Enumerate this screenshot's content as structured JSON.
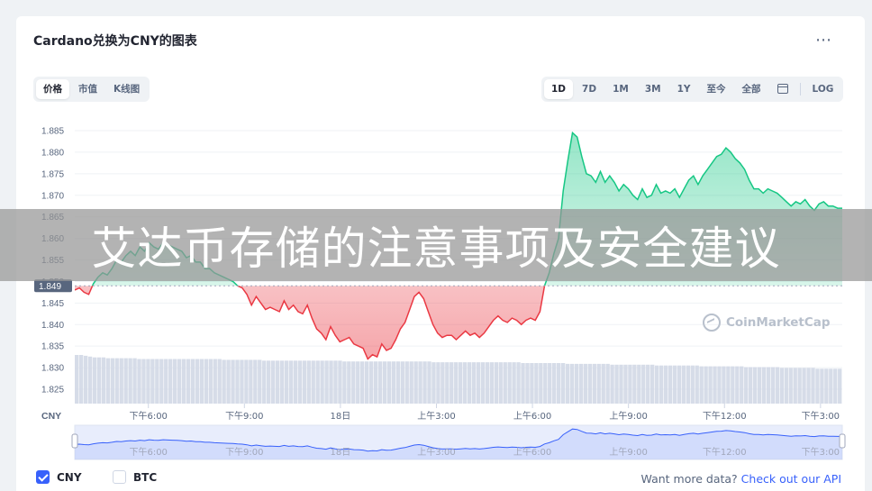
{
  "title": "Cardano兑换为CNY的图表",
  "more_icon": "⋯",
  "tabs_left": [
    {
      "label": "价格",
      "active": true
    },
    {
      "label": "市值",
      "active": false
    },
    {
      "label": "K线图",
      "active": false
    }
  ],
  "tabs_right": [
    {
      "label": "1D",
      "active": true
    },
    {
      "label": "7D",
      "active": false
    },
    {
      "label": "1M",
      "active": false
    },
    {
      "label": "3M",
      "active": false
    },
    {
      "label": "1Y",
      "active": false
    },
    {
      "label": "至今",
      "active": false
    },
    {
      "label": "全部",
      "active": false
    }
  ],
  "log_label": "LOG",
  "calendar_icon": "calendar-icon",
  "banner_text": "艾达币存储的注意事项及安全建议",
  "watermark": "CoinMarketCap",
  "legend": [
    {
      "label": "CNY",
      "checked": true
    },
    {
      "label": "BTC",
      "checked": false
    }
  ],
  "api_text": "Want more data?",
  "api_link": "Check out our API",
  "colors": {
    "up": "#16c784",
    "down": "#ea3943",
    "accent": "#3861fb",
    "nav_line": "#3861fb"
  },
  "chart_data": {
    "type": "area",
    "currency_label": "CNY",
    "baseline": 1.849,
    "baseline_label": "1.849",
    "ylim": [
      1.825,
      1.885
    ],
    "yticks": [
      1.825,
      1.83,
      1.835,
      1.84,
      1.845,
      1.85,
      1.855,
      1.86,
      1.865,
      1.87,
      1.875,
      1.88,
      1.885
    ],
    "ytick_labels": [
      "1.825",
      "1.830",
      "1.835",
      "1.840",
      "1.845",
      "1.850",
      "1.855",
      "1.860",
      "1.865",
      "1.870",
      "1.875",
      "1.880",
      "1.885"
    ],
    "xlabels": [
      "下午6:00",
      "下午9:00",
      "18日",
      "上午3:00",
      "上午6:00",
      "上午9:00",
      "下午12:00",
      "下午3:00"
    ],
    "x_hours": [
      0,
      23.98
    ],
    "xlabel_hours": [
      2.3,
      5.3,
      8.3,
      11.3,
      14.3,
      17.3,
      20.3,
      23.3
    ],
    "series": [
      {
        "values": [
          1.848,
          1.8485,
          1.8475,
          1.847,
          1.8495,
          1.851,
          1.852,
          1.8515,
          1.853,
          1.855,
          1.8545,
          1.856,
          1.857,
          1.856,
          1.858,
          1.857,
          1.859,
          1.858,
          1.8575,
          1.859,
          1.8585,
          1.858,
          1.8575,
          1.857,
          1.8555,
          1.856,
          1.8545,
          1.8545,
          1.853,
          1.853,
          1.852,
          1.8515,
          1.851,
          1.8505,
          1.85,
          1.849,
          1.8485,
          1.847,
          1.8445,
          1.8465,
          1.845,
          1.8435,
          1.844,
          1.8435,
          1.843,
          1.8455,
          1.8435,
          1.8445,
          1.843,
          1.8425,
          1.8445,
          1.8415,
          1.839,
          1.838,
          1.8365,
          1.8395,
          1.8375,
          1.836,
          1.8365,
          1.837,
          1.8355,
          1.835,
          1.8345,
          1.832,
          1.833,
          1.8325,
          1.8355,
          1.834,
          1.8345,
          1.8365,
          1.839,
          1.8405,
          1.8435,
          1.8465,
          1.8475,
          1.846,
          1.843,
          1.84,
          1.838,
          1.837,
          1.8375,
          1.8375,
          1.8365,
          1.8375,
          1.8385,
          1.8375,
          1.838,
          1.837,
          1.838,
          1.8395,
          1.841,
          1.842,
          1.841,
          1.8405,
          1.8415,
          1.841,
          1.84,
          1.841,
          1.8415,
          1.841,
          1.843,
          1.849,
          1.852,
          1.8565,
          1.86,
          1.871,
          1.878,
          1.8845,
          1.8835,
          1.879,
          1.875,
          1.8745,
          1.873,
          1.8755,
          1.873,
          1.8745,
          1.873,
          1.871,
          1.8725,
          1.8715,
          1.87,
          1.869,
          1.8715,
          1.8695,
          1.87,
          1.8725,
          1.8705,
          1.871,
          1.8705,
          1.8715,
          1.8695,
          1.8715,
          1.8735,
          1.8745,
          1.8725,
          1.8745,
          1.876,
          1.8775,
          1.879,
          1.8795,
          1.881,
          1.88,
          1.8785,
          1.8775,
          1.876,
          1.8735,
          1.8715,
          1.8715,
          1.8705,
          1.8715,
          1.871,
          1.8705,
          1.8695,
          1.8685,
          1.8675,
          1.8685,
          1.868,
          1.869,
          1.8675,
          1.8665,
          1.868,
          1.8685,
          1.8675,
          1.8675,
          1.867,
          1.867
        ]
      },
      {
        "name": "volume",
        "values": [
          60,
          60,
          59,
          58,
          57,
          57,
          57,
          56,
          56,
          56,
          56,
          56,
          56,
          56,
          55,
          55,
          55,
          55,
          55,
          55,
          55,
          55,
          55,
          55,
          55,
          55,
          55,
          55,
          55,
          55,
          55,
          55,
          55,
          54,
          54,
          54,
          54,
          54,
          54,
          54,
          54,
          54,
          53,
          53,
          53,
          53,
          53,
          53,
          53,
          53,
          53,
          53,
          53,
          53,
          53,
          53,
          53,
          53,
          53,
          53,
          52,
          52,
          52,
          52,
          52,
          52,
          52,
          52,
          52,
          52,
          52,
          52,
          52,
          52,
          52,
          52,
          52,
          52,
          52,
          52,
          51,
          51,
          51,
          51,
          51,
          51,
          51,
          51,
          51,
          51,
          51,
          51,
          51,
          51,
          51,
          51,
          51,
          51,
          51,
          51,
          50,
          50,
          50,
          50,
          50,
          50,
          50,
          50,
          50,
          50,
          49,
          49,
          49,
          49,
          49,
          49,
          49,
          49,
          49,
          49,
          48,
          48,
          48,
          48,
          48,
          48,
          48,
          48,
          48,
          48,
          47,
          47,
          47,
          47,
          47,
          47,
          47,
          47,
          47,
          47,
          46,
          46,
          46,
          46,
          46,
          46,
          46,
          46,
          46,
          46,
          45,
          45,
          45,
          45,
          45,
          45,
          45,
          45,
          44,
          44,
          44,
          44,
          44,
          44,
          44,
          44,
          43,
          43,
          43,
          43,
          43,
          43
        ]
      }
    ],
    "grid": true
  }
}
